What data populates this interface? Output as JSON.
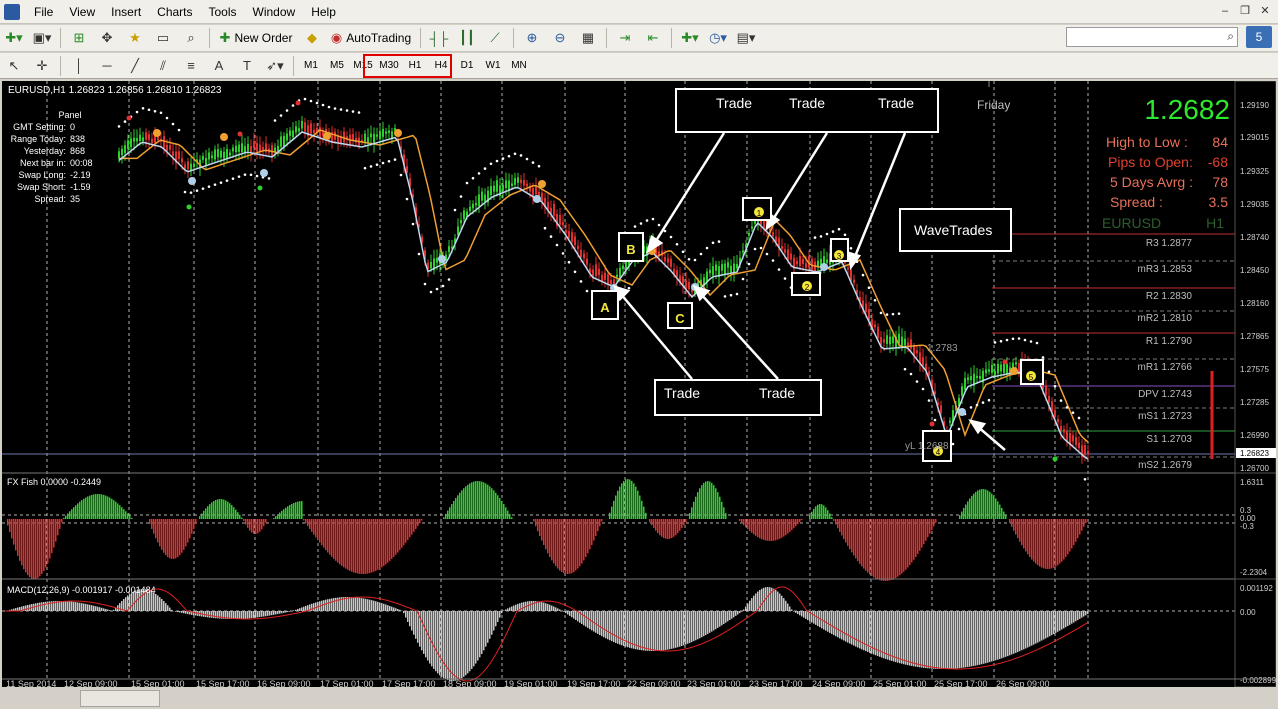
{
  "menu": [
    "File",
    "View",
    "Insert",
    "Charts",
    "Tools",
    "Window",
    "Help"
  ],
  "toolbar": {
    "new_order": "New Order",
    "autotrading": "AutoTrading"
  },
  "timeframes": [
    "M1",
    "M5",
    "M15",
    "M30",
    "H1",
    "H4",
    "D1",
    "W1",
    "MN"
  ],
  "chart": {
    "symbol_header": "EURUSD,H1  1.26823 1.26856 1.26810 1.26823",
    "big_price": "1.2682",
    "day_label": "Friday",
    "info_rows": [
      {
        "label": "High to Low   :",
        "value": "84",
        "label_color": "#e8705a",
        "value_color": "#e8705a"
      },
      {
        "label": "Pips to Open:",
        "value": "-68",
        "label_color": "#e04030",
        "value_color": "#e04030"
      },
      {
        "label": "5 Days Avrg :",
        "value": "78",
        "label_color": "#e8705a",
        "value_color": "#e8705a"
      },
      {
        "label": "Spread          :",
        "value": "3.5",
        "label_color": "#e8705a",
        "value_color": "#e8705a"
      }
    ],
    "symbol_label": "EURUSD",
    "tf_label": "H1",
    "panel": {
      "title": "Panel",
      "rows": [
        [
          "GMT Setting:",
          "0"
        ],
        [
          "Range Today:",
          "838"
        ],
        [
          "Yesterday:",
          "868"
        ],
        [
          "Next bar in:",
          "00:08"
        ],
        [
          "Swap Long:",
          "-2.19"
        ],
        [
          "Swap Short:",
          "-1.59"
        ],
        [
          "Spread:",
          "35"
        ]
      ]
    },
    "pivots": [
      {
        "label": "R3 1.2877",
        "color": "#c03030"
      },
      {
        "label": "mR3 1.2853",
        "color": "#7a7a7a"
      },
      {
        "label": "R2 1.2830",
        "color": "#c03030"
      },
      {
        "label": "mR2 1.2810",
        "color": "#7a7a7a"
      },
      {
        "label": "R1 1.2790",
        "color": "#c03030"
      },
      {
        "label": "mR1 1.2766",
        "color": "#7a7a7a"
      },
      {
        "label": "DPV 1.2743",
        "color": "#8a50c0"
      },
      {
        "label": "mS1 1.2723",
        "color": "#7a7a7a"
      },
      {
        "label": "S1 1.2703",
        "color": "#30a040"
      },
      {
        "label": "mS2 1.2679",
        "color": "#7a7a7a"
      }
    ],
    "price_scale": [
      "1.29190",
      "1.29015",
      "1.29325",
      "1.29035",
      "1.28740",
      "1.28450",
      "1.28160",
      "1.27865",
      "1.27575",
      "1.27285",
      "1.26990",
      "1.26823",
      "1.26700"
    ],
    "annotations": {
      "trade_top": [
        "Trade",
        "Trade",
        "Trade"
      ],
      "trade_bottom": [
        "Trade",
        "Trade"
      ],
      "wavetrades": "WaveTrades",
      "letters": [
        "A",
        "B",
        "C"
      ],
      "numbers": [
        "1",
        "2",
        "3",
        "4",
        "5"
      ],
      "line_labels": [
        "1.2783",
        "yL 1.2688"
      ]
    },
    "fish": {
      "header": "FX Fish 0.0000 -0.2449",
      "scale": [
        "1.6311",
        "0.3",
        "0.00",
        "-0.3",
        "-2.2304"
      ]
    },
    "macd": {
      "header": "MACD(12,26,9) -0.001917 -0.001484",
      "scale": [
        "0.001192",
        "0.00",
        "-0.002899"
      ]
    },
    "dates": [
      "11 Sep 2014",
      "12 Sep 09:00",
      "15 Sep 01:00",
      "15 Sep 17:00",
      "16 Sep 09:00",
      "17 Sep 01:00",
      "17 Sep 17:00",
      "18 Sep 09:00",
      "19 Sep 01:00",
      "19 Sep 17:00",
      "22 Sep 09:00",
      "23 Sep 01:00",
      "23 Sep 17:00",
      "24 Sep 09:00",
      "25 Sep 01:00",
      "25 Sep 17:00",
      "26 Sep 09:00"
    ]
  }
}
